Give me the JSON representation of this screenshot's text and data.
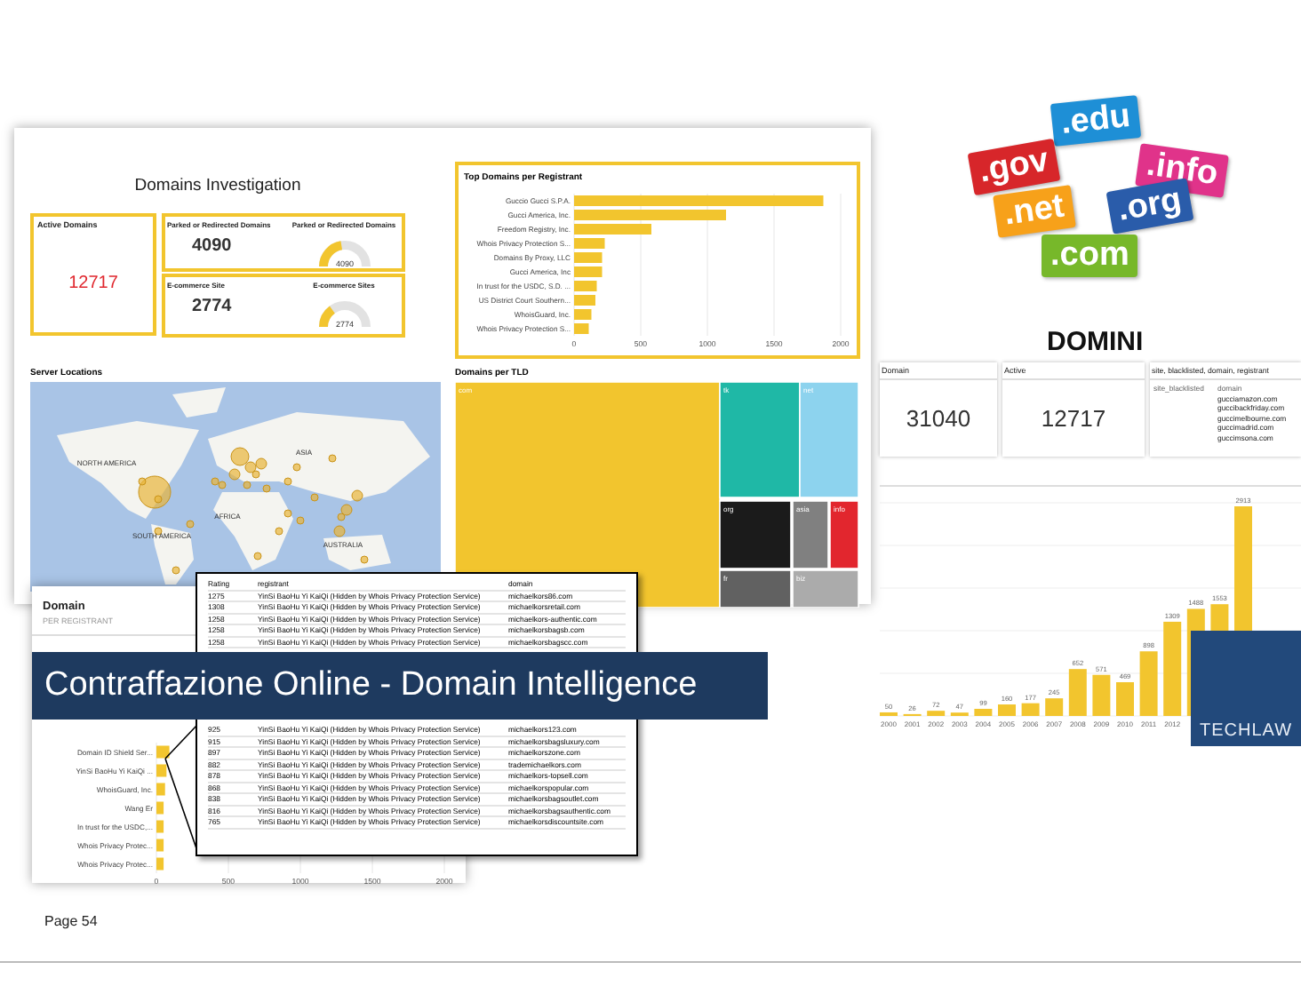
{
  "investigation": {
    "title": "Domains Investigation",
    "active": {
      "label": "Active Domains",
      "value": "12717"
    },
    "metrics": [
      {
        "label": "Parked or Redirected Domains",
        "value": "4090",
        "gauge_label": "Parked or Redirected Domains",
        "gauge_value": "4090",
        "level": 0.45
      },
      {
        "label": "E-commerce Site",
        "value": "2774",
        "gauge_label": "E-commerce Sites",
        "gauge_value": "2774",
        "level": 0.3
      }
    ],
    "top_registrants": {
      "title": "Top Domains per Registrant",
      "chart_data": {
        "type": "bar",
        "orientation": "horizontal",
        "categories": [
          "Guccio Gucci S.P.A.",
          "Gucci America, Inc.",
          "Freedom Registry, Inc.",
          "Whois Privacy Protection S...",
          "Domains By Proxy, LLC",
          "Gucci America, Inc",
          "In trust for the USDC, S.D. ...",
          "US District Court Southern...",
          "WhoisGuard, Inc.",
          "Whois Privacy Protection S..."
        ],
        "values": [
          1870,
          1140,
          580,
          230,
          210,
          210,
          170,
          160,
          130,
          110
        ],
        "xticks": [
          0,
          500,
          1000,
          1500,
          2000
        ],
        "xlim": [
          0,
          2000
        ],
        "grid": true
      }
    },
    "server_locations": {
      "title": "Server Locations",
      "regions": [
        "NORTH AMERICA",
        "ASIA",
        "AFRICA",
        "SOUTH AMERICA",
        "AUSTRALIA"
      ]
    },
    "tld": {
      "title": "Domains per TLD",
      "tiles": [
        {
          "label": "com",
          "color": "#f2c52e"
        },
        {
          "label": "tk",
          "color": "#1fb8a6"
        },
        {
          "label": "net",
          "color": "#8dd3ee"
        },
        {
          "label": "org",
          "color": "#1b1b1b"
        },
        {
          "label": "asia",
          "color": "#808080"
        },
        {
          "label": "info",
          "color": "#e2262e"
        },
        {
          "label": "fr",
          "color": "#616161"
        },
        {
          "label": "biz",
          "color": "#ababab"
        }
      ]
    }
  },
  "registrant_panel": {
    "title": "Domain",
    "subtitle": "PER REGISTRANT",
    "chart_data": {
      "type": "bar",
      "orientation": "horizontal",
      "categories": [
        "Domain ID Shield Ser...",
        "YinSi BaoHu Yi KaiQi ...",
        "WhoisGuard, Inc.",
        "Wang Er",
        "In trust for the USDC,...",
        "Whois Privacy Protec...",
        "Whois Privacy Protec..."
      ],
      "values": [
        90,
        70,
        60,
        50,
        50,
        50,
        50
      ],
      "xticks": [
        0,
        500,
        1000,
        1500,
        2000
      ],
      "xlim": [
        0,
        2000
      ],
      "grid": true
    }
  },
  "registrant_table": {
    "columns": [
      "Rating",
      "registrant",
      "domain"
    ],
    "rows_above": [
      {
        "rating": "1275",
        "registrant": "YinSi BaoHu Yi KaiQi (Hidden by Whois Privacy Protection Service)",
        "domain": "michaelkors86.com"
      },
      {
        "rating": "1308",
        "registrant": "YinSi BaoHu Yi KaiQi (Hidden by Whois Privacy Protection Service)",
        "domain": "michaelkorsretail.com"
      },
      {
        "rating": "1258",
        "registrant": "YinSi BaoHu Yi KaiQi (Hidden by Whois Privacy Protection Service)",
        "domain": "michaelkors-authentic.com"
      },
      {
        "rating": "1258",
        "registrant": "YinSi BaoHu Yi KaiQi (Hidden by Whois Privacy Protection Service)",
        "domain": "michaelkorsbagsb.com"
      },
      {
        "rating": "1258",
        "registrant": "YinSi BaoHu Yi KaiQi (Hidden by Whois Privacy Protection Service)",
        "domain": "michaelkorsbagscc.com"
      }
    ],
    "rows_below": [
      {
        "rating": "925",
        "registrant": "YinSi BaoHu Yi KaiQi (Hidden by Whois Privacy Protection Service)",
        "domain": "michaelkors123.com"
      },
      {
        "rating": "915",
        "registrant": "YinSi BaoHu Yi KaiQi (Hidden by Whois Privacy Protection Service)",
        "domain": "michaelkorsbagsluxury.com"
      },
      {
        "rating": "897",
        "registrant": "YinSi BaoHu Yi KaiQi (Hidden by Whois Privacy Protection Service)",
        "domain": "michaelkorszone.com"
      },
      {
        "rating": "882",
        "registrant": "YinSi BaoHu Yi KaiQi (Hidden by Whois Privacy Protection Service)",
        "domain": "trademichaelkors.com"
      },
      {
        "rating": "878",
        "registrant": "YinSi BaoHu Yi KaiQi (Hidden by Whois Privacy Protection Service)",
        "domain": "michaelkors-topsell.com"
      },
      {
        "rating": "868",
        "registrant": "YinSi BaoHu Yi KaiQi (Hidden by Whois Privacy Protection Service)",
        "domain": "michaelkorspopular.com"
      },
      {
        "rating": "838",
        "registrant": "YinSi BaoHu Yi KaiQi (Hidden by Whois Privacy Protection Service)",
        "domain": "michaelkorsbagsoutlet.com"
      },
      {
        "rating": "816",
        "registrant": "YinSi BaoHu Yi KaiQi (Hidden by Whois Privacy Protection Service)",
        "domain": "michaelkorsbagsauthentic.com"
      },
      {
        "rating": "765",
        "registrant": "YinSi BaoHu Yi KaiQi (Hidden by Whois Privacy Protection Service)",
        "domain": "michaelkorsdiscountsite.com"
      }
    ]
  },
  "banner": {
    "title": "Contraffazione Online - Domain Intelligence"
  },
  "domini": {
    "tags": [
      {
        "label": ".edu",
        "color": "#1e8fd6"
      },
      {
        "label": ".gov",
        "color": "#d7262a"
      },
      {
        "label": ".info",
        "color": "#e0338a"
      },
      {
        "label": ".net",
        "color": "#f7a11a"
      },
      {
        "label": ".org",
        "color": "#2a5caa"
      },
      {
        "label": ".com",
        "color": "#77b82a"
      }
    ],
    "title": "DOMINI",
    "cards": [
      {
        "label": "Domain",
        "value": "31040"
      },
      {
        "label": "Active",
        "value": "12717"
      }
    ],
    "table": {
      "title": "site, blacklisted, domain, registrant",
      "columns": [
        "site_blacklisted",
        "domain"
      ],
      "rows": [
        "gucciamazon.com",
        "guccibackfriday.com",
        "guccimelbourne.com",
        "guccimadrid.com",
        "guccimsona.com"
      ]
    },
    "chart_data": {
      "type": "bar",
      "categories": [
        "2000",
        "2001",
        "2002",
        "2003",
        "2004",
        "2005",
        "2006",
        "2007",
        "2008",
        "2009",
        "2010",
        "2011",
        "2012",
        null,
        null,
        null
      ],
      "values": [
        50,
        26,
        72,
        47,
        99,
        160,
        177,
        245,
        652,
        571,
        469,
        898,
        1309,
        1488,
        1553,
        2913
      ],
      "data_labels": true
    }
  },
  "brand": {
    "name": "TECHLAW"
  },
  "footer": {
    "page": "Page 54"
  }
}
